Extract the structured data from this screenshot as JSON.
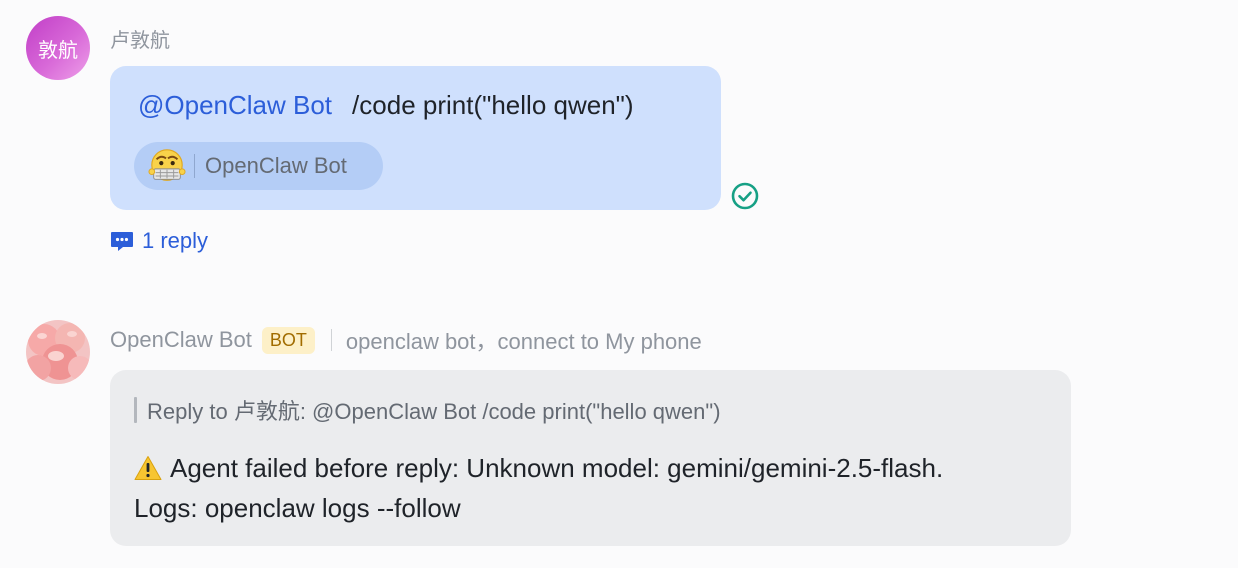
{
  "user_message": {
    "avatar_text": "敦航",
    "sender_name": "卢敦航",
    "mention": "@OpenClaw Bot",
    "text": "/code print(\"hello qwen\")",
    "mention_chip_label": "OpenClaw Bot",
    "read_status_icon": "check-circle-icon",
    "reply_count_label": "1 reply"
  },
  "bot_message": {
    "sender_name": "OpenClaw Bot",
    "badge": "BOT",
    "description": "openclaw bot，connect to My phone",
    "quote_text": "Reply to 卢敦航:  @OpenClaw Bot /code print(\"hello qwen\")",
    "body_line1": "Agent failed before reply: Unknown model: gemini/gemini-2.5-flash.",
    "body_line2": "Logs: openclaw logs --follow",
    "warning_icon": "warning-icon"
  },
  "colors": {
    "accent": "#2c5ed9",
    "user_bubble": "#cfe0fd",
    "bot_bubble": "#ebecee",
    "read_check": "#16a085",
    "badge_bg": "#fdf0c8",
    "badge_text": "#a16c00"
  }
}
